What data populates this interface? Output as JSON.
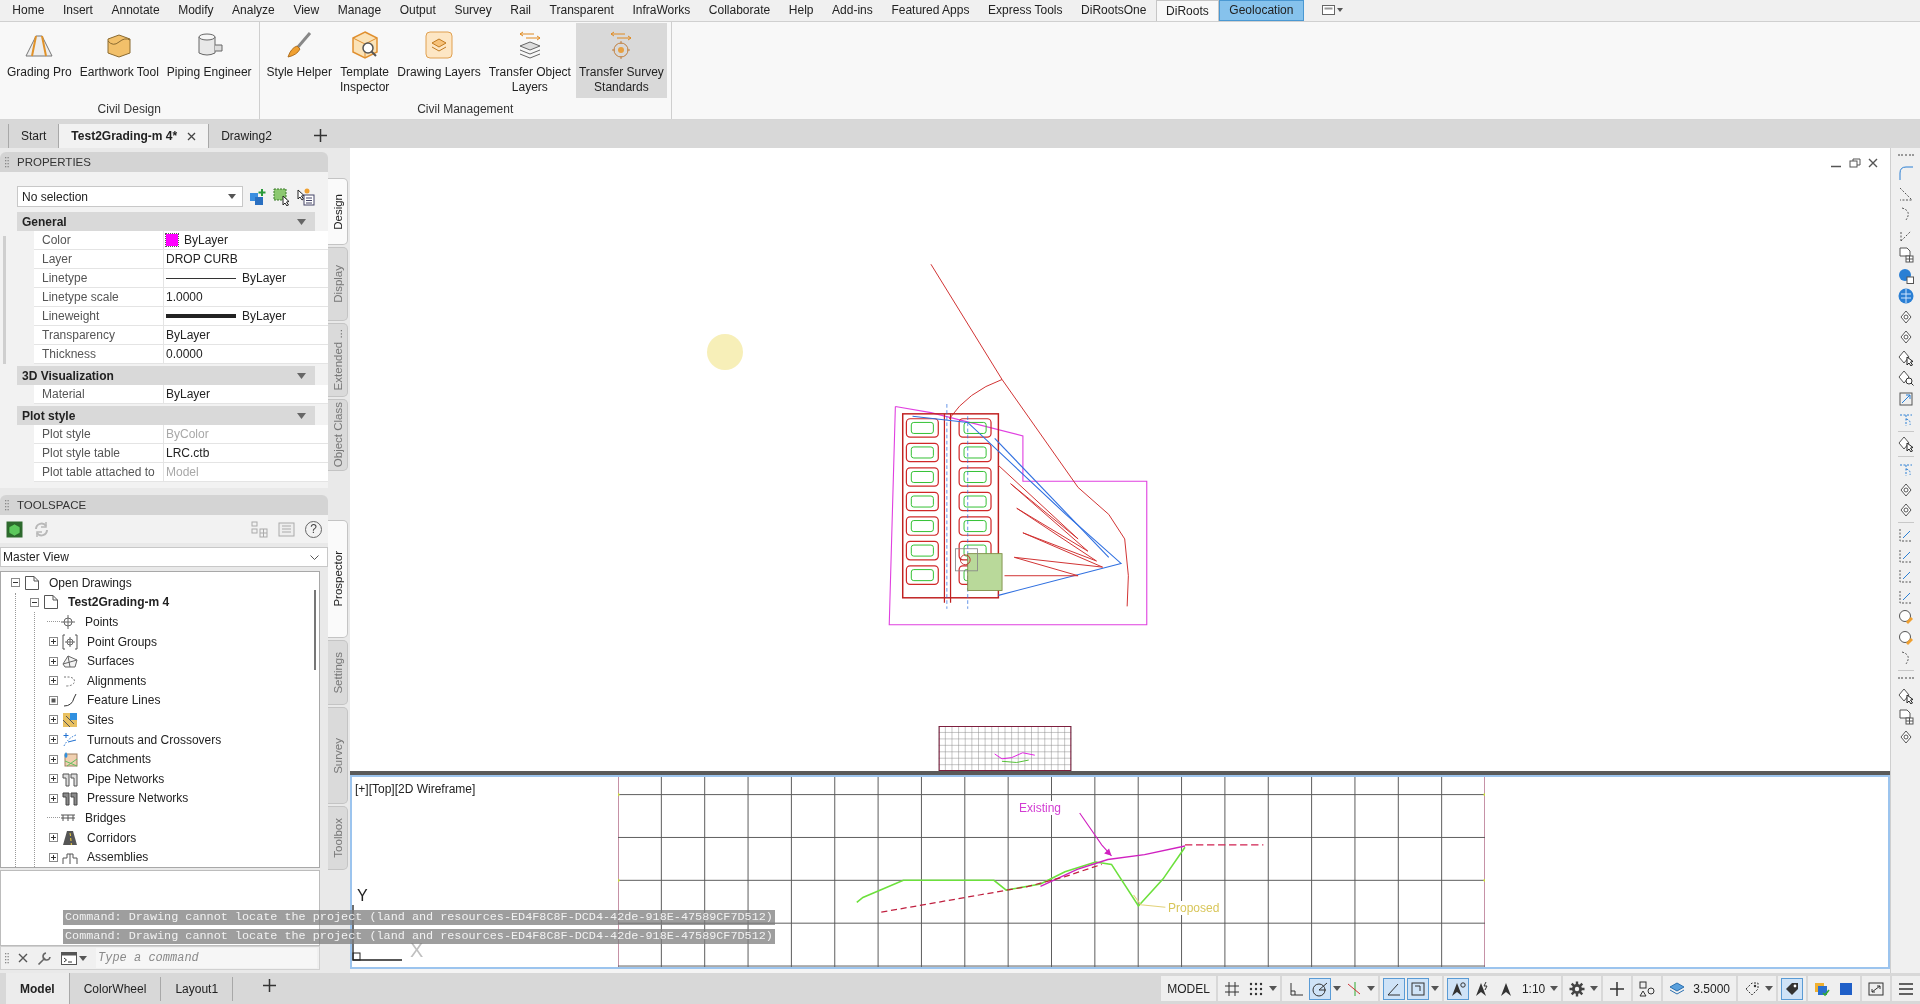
{
  "ribbon_tabs": [
    {
      "label": "Home",
      "selected": false,
      "contextual": false
    },
    {
      "label": "Insert",
      "selected": false,
      "contextual": false
    },
    {
      "label": "Annotate",
      "selected": false,
      "contextual": false
    },
    {
      "label": "Modify",
      "selected": false,
      "contextual": false
    },
    {
      "label": "Analyze",
      "selected": false,
      "contextual": false
    },
    {
      "label": "View",
      "selected": false,
      "contextual": false
    },
    {
      "label": "Manage",
      "selected": false,
      "contextual": false
    },
    {
      "label": "Output",
      "selected": false,
      "contextual": false
    },
    {
      "label": "Survey",
      "selected": false,
      "contextual": false
    },
    {
      "label": "Rail",
      "selected": false,
      "contextual": false
    },
    {
      "label": "Transparent",
      "selected": false,
      "contextual": false
    },
    {
      "label": "InfraWorks",
      "selected": false,
      "contextual": false
    },
    {
      "label": "Collaborate",
      "selected": false,
      "contextual": false
    },
    {
      "label": "Help",
      "selected": false,
      "contextual": false
    },
    {
      "label": "Add-ins",
      "selected": false,
      "contextual": false
    },
    {
      "label": "Featured Apps",
      "selected": false,
      "contextual": false
    },
    {
      "label": "Express Tools",
      "selected": false,
      "contextual": false
    },
    {
      "label": "DiRootsOne",
      "selected": false,
      "contextual": false
    },
    {
      "label": "DiRoots",
      "selected": true,
      "contextual": false
    },
    {
      "label": "Geolocation",
      "selected": false,
      "contextual": true
    }
  ],
  "ribbon_panels": [
    {
      "title": "Civil Design",
      "buttons": [
        {
          "label": "Grading Pro",
          "hovered": false
        },
        {
          "label": "Earthwork Tool",
          "hovered": false
        },
        {
          "label": "Piping Engineer",
          "hovered": false
        }
      ]
    },
    {
      "title": "Civil Management",
      "buttons": [
        {
          "label": "Style Helper",
          "hovered": false
        },
        {
          "label": "Template\nInspector",
          "hovered": false
        },
        {
          "label": "Drawing Layers",
          "hovered": false
        },
        {
          "label": "Transfer Object\nLayers",
          "hovered": false
        },
        {
          "label": "Transfer Survey\nStandards",
          "hovered": true
        }
      ]
    }
  ],
  "file_tabs": [
    {
      "label": "Start",
      "selected": false
    },
    {
      "label": "Test2Grading-m 4*",
      "selected": true
    },
    {
      "label": "Drawing2",
      "selected": false
    }
  ],
  "properties": {
    "title": "PROPERTIES",
    "selection": "No selection",
    "sections": [
      {
        "title": "General",
        "expanded": true,
        "rows": [
          {
            "label": "Color",
            "value": "ByLayer",
            "kind": "swatch",
            "color": "#ff00ff",
            "disabled": false
          },
          {
            "label": "Layer",
            "value": "DROP CURB",
            "kind": "text",
            "disabled": false
          },
          {
            "label": "Linetype",
            "value": "ByLayer",
            "kind": "linetype",
            "disabled": false
          },
          {
            "label": "Linetype scale",
            "value": "1.0000",
            "kind": "text",
            "disabled": false
          },
          {
            "label": "Lineweight",
            "value": "ByLayer",
            "kind": "lineweight",
            "disabled": false
          },
          {
            "label": "Transparency",
            "value": "ByLayer",
            "kind": "text",
            "disabled": false
          },
          {
            "label": "Thickness",
            "value": "0.0000",
            "kind": "text",
            "disabled": false
          }
        ]
      },
      {
        "title": "3D Visualization",
        "expanded": true,
        "rows": [
          {
            "label": "Material",
            "value": "ByLayer",
            "kind": "text",
            "disabled": false
          }
        ]
      },
      {
        "title": "Plot style",
        "expanded": true,
        "rows": [
          {
            "label": "Plot style",
            "value": "ByColor",
            "kind": "text",
            "disabled": true
          },
          {
            "label": "Plot style table",
            "value": "LRC.ctb",
            "kind": "text",
            "disabled": false
          },
          {
            "label": "Plot table attached to",
            "value": "Model",
            "kind": "text",
            "disabled": true
          }
        ]
      }
    ],
    "side_tabs": [
      {
        "label": "Design",
        "selected": true
      },
      {
        "label": "Display",
        "selected": false
      },
      {
        "label": "Extended ...",
        "selected": false
      },
      {
        "label": "Object Class",
        "selected": false
      }
    ]
  },
  "toolspace": {
    "title": "TOOLSPACE",
    "help": "?",
    "view": "Master View",
    "tree": [
      {
        "label": "Open Drawings",
        "kind": "branch",
        "expanded": true,
        "current": false,
        "children": [
          {
            "label": "Test2Grading-m 4",
            "kind": "branch",
            "expanded": true,
            "current": true,
            "children": [
              {
                "label": "Points",
                "kind": "leaf",
                "current": false
              },
              {
                "label": "Point Groups",
                "kind": "branch",
                "expanded": false,
                "current": false
              },
              {
                "label": "Surfaces",
                "kind": "branch",
                "expanded": false,
                "current": false
              },
              {
                "label": "Alignments",
                "kind": "branch",
                "expanded": false,
                "current": false
              },
              {
                "label": "Feature Lines",
                "kind": "dotted",
                "current": false
              },
              {
                "label": "Sites",
                "kind": "branch",
                "expanded": false,
                "current": false
              },
              {
                "label": "Turnouts and Crossovers",
                "kind": "branch",
                "expanded": false,
                "current": false
              },
              {
                "label": "Catchments",
                "kind": "branch",
                "expanded": false,
                "current": false
              },
              {
                "label": "Pipe Networks",
                "kind": "branch",
                "expanded": false,
                "current": false
              },
              {
                "label": "Pressure Networks",
                "kind": "branch",
                "expanded": false,
                "current": false
              },
              {
                "label": "Bridges",
                "kind": "leaf",
                "current": false
              },
              {
                "label": "Corridors",
                "kind": "branch",
                "expanded": false,
                "current": false
              },
              {
                "label": "Assemblies",
                "kind": "branch",
                "expanded": false,
                "current": false
              }
            ]
          }
        ]
      }
    ],
    "side_tabs": [
      {
        "label": "Prospector",
        "selected": true
      },
      {
        "label": "Settings",
        "selected": false
      },
      {
        "label": "Survey",
        "selected": false
      },
      {
        "label": "Toolbox",
        "selected": false
      }
    ]
  },
  "viewport": {
    "label": "[+][Top][2D Wireframe]",
    "axis_labels": [
      "Y",
      "X"
    ],
    "profile_labels": [
      {
        "text": "Existing",
        "color": "#d23cd2"
      },
      {
        "text": "Proposed",
        "color": "#d8c65a"
      }
    ]
  },
  "command_line": {
    "history": [
      "Command: Drawing cannot locate the project (land and resources-ED4F8C8F-DCD4-42de-918E-47589CF7D512)",
      "Command: Drawing cannot locate the project (land and resources-ED4F8C8F-DCD4-42de-918E-47589CF7D512)"
    ],
    "placeholder": "Type a command"
  },
  "layout_tabs": [
    {
      "label": "Model",
      "selected": true
    },
    {
      "label": "ColorWheel",
      "selected": false
    },
    {
      "label": "Layout1",
      "selected": false
    }
  ],
  "status_bar": {
    "mode": "MODEL",
    "toggles": [
      {
        "on": false
      },
      {
        "on": false
      },
      {
        "on": false
      },
      {
        "on": true
      },
      {
        "on": false
      },
      {
        "on": true
      },
      {
        "on": true
      },
      {
        "on": true
      },
      {
        "on": false
      },
      {
        "on": false
      },
      {
        "on": true
      }
    ],
    "scale": "1:10",
    "value": "3.5000"
  }
}
